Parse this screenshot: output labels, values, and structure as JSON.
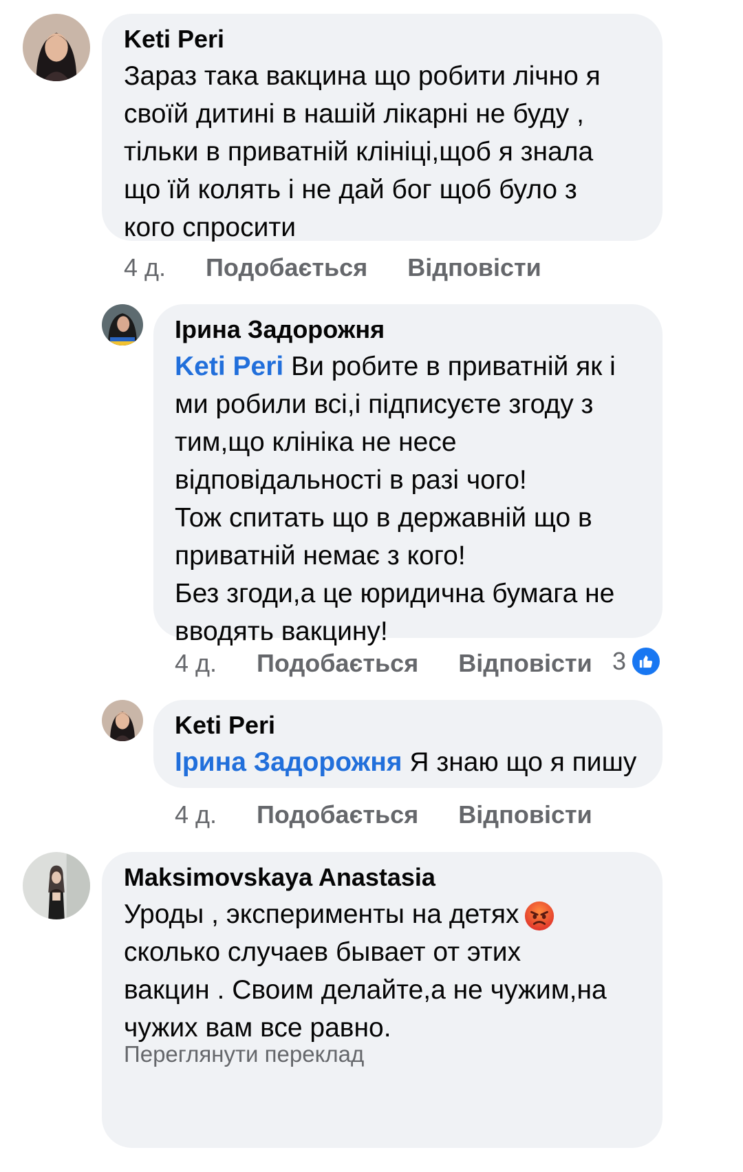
{
  "comments": [
    {
      "author": "Keti Peri",
      "lines": [
        "Зараз така вакцина що робити лічно я",
        "своїй дитині в нашій лікарні не буду ,",
        "тільки в приватній клініці,щоб я знала",
        "що їй колять і не дай бог щоб було з",
        "кого спросити"
      ],
      "time": "4 д.",
      "like_label": "Подобається",
      "reply_label": "Відповісти"
    },
    {
      "author": "Ірина Задорожня",
      "mention": "Keti Peri",
      "first_line_rest": " Ви робите в приватній як і",
      "lines": [
        "ми робили всі,і підписуєте згоду з",
        "тим,що клініка не несе",
        "відповідальності в разі чого!",
        "Тож спитать що в державній що в",
        "приватній немає з кого!",
        "Без згоди,а це юридична бумага не",
        "вводять вакцину!"
      ],
      "time": "4 д.",
      "like_label": "Подобається",
      "reply_label": "Відповісти",
      "reaction_count": "3"
    },
    {
      "author": "Keti Peri",
      "mention": "Ірина Задорожня",
      "first_line_rest": " Я знаю що я пишу",
      "time": "4 д.",
      "like_label": "Подобається",
      "reply_label": "Відповісти"
    },
    {
      "author": "Maksimovskaya Anastasia",
      "first_line": "Уроды , эксперименты на детях",
      "emoji": "angry-face-emoji",
      "lines": [
        "сколько случаев бывает от этих",
        "вакцин . Своим делайте,а не чужим,на",
        "чужих вам все равно."
      ],
      "translate_label": "Переглянути переклад"
    }
  ],
  "colors": {
    "bubble": "#f0f2f5",
    "mention": "#216fdb",
    "meta": "#65676b",
    "like": "#1877f2"
  }
}
